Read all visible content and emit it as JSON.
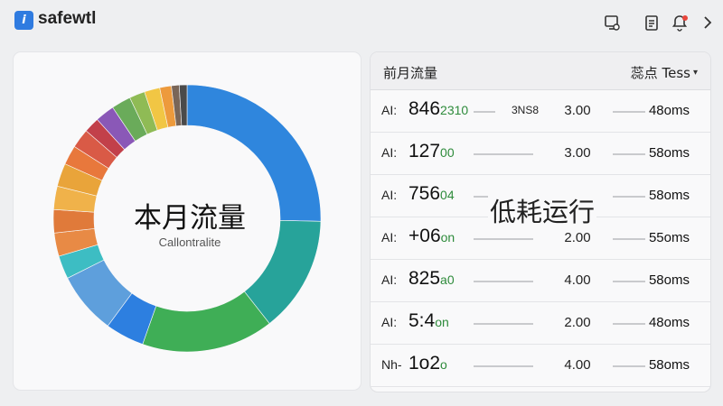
{
  "app": {
    "logo_glyph": "i",
    "name": "safewtl"
  },
  "topbar": {
    "icons": [
      "monitor-icon",
      "clipboard-icon",
      "bell-icon",
      "chevron-right-icon"
    ],
    "notification_color": "#e8453c"
  },
  "donut": {
    "title": "本月流量",
    "subtitle": "Callontralite",
    "segments": [
      {
        "color": "#2f86dd",
        "value": 27
      },
      {
        "color": "#27a39a",
        "value": 15
      },
      {
        "color": "#3fae56",
        "value": 17
      },
      {
        "color": "#2d7fe0",
        "value": 5
      },
      {
        "color": "#5e9fdc",
        "value": 8
      },
      {
        "color": "#3dbdc3",
        "value": 3
      },
      {
        "color": "#e88a45",
        "value": 3
      },
      {
        "color": "#e07a3a",
        "value": 3
      },
      {
        "color": "#f0b24a",
        "value": 3
      },
      {
        "color": "#e9a43a",
        "value": 3
      },
      {
        "color": "#e8783c",
        "value": 2.5
      },
      {
        "color": "#d95a46",
        "value": 2.5
      },
      {
        "color": "#c2404a",
        "value": 2
      },
      {
        "color": "#8a58b7",
        "value": 2.5
      },
      {
        "color": "#6aab5a",
        "value": 2.5
      },
      {
        "color": "#8fbb55",
        "value": 2
      },
      {
        "color": "#f1c644",
        "value": 2
      },
      {
        "color": "#ed9a3c",
        "value": 1.5
      },
      {
        "color": "#7a6658",
        "value": 1
      },
      {
        "color": "#4a4a4a",
        "value": 1
      }
    ]
  },
  "table": {
    "title": "前月流量",
    "filter_label": "蕊点 Tess",
    "overlay_text": "低耗运行",
    "rows": [
      {
        "prefix": "AI:",
        "value": "846",
        "suffix": "2310",
        "tag": "3NS8",
        "num": "3.00",
        "ms": "48oms"
      },
      {
        "prefix": "AI:",
        "value": "127",
        "suffix": "00",
        "tag": "",
        "num": "3.00",
        "ms": "58oms"
      },
      {
        "prefix": "AI:",
        "value": "756",
        "suffix": "04",
        "tag": "",
        "num": "",
        "ms": "58oms"
      },
      {
        "prefix": "AI:",
        "value": "+06",
        "suffix": "on",
        "tag": "",
        "num": "2.00",
        "ms": "55oms"
      },
      {
        "prefix": "AI:",
        "value": "825",
        "suffix": "a0",
        "tag": "",
        "num": "4.00",
        "ms": "58oms"
      },
      {
        "prefix": "AI:",
        "value": "5:4",
        "suffix": "on",
        "tag": "",
        "num": "2.00",
        "ms": "48oms"
      },
      {
        "prefix": "Nh-",
        "value": "1o2",
        "suffix": "o",
        "tag": "",
        "num": "4.00",
        "ms": "58oms"
      }
    ]
  }
}
